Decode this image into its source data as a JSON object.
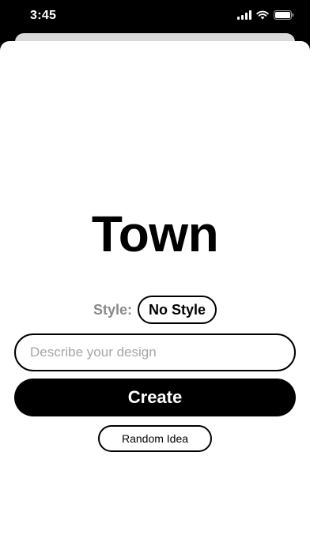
{
  "status_bar": {
    "time": "3:45"
  },
  "main": {
    "title": "Town",
    "style_label": "Style:",
    "style_value": "No Style",
    "describe_placeholder": "Describe your design",
    "describe_value": "",
    "create_label": "Create",
    "random_idea_label": "Random Idea"
  },
  "colors": {
    "primary": "#000000",
    "background": "#ffffff",
    "muted_label": "#8a8a8e",
    "placeholder": "#a6a6aa"
  }
}
